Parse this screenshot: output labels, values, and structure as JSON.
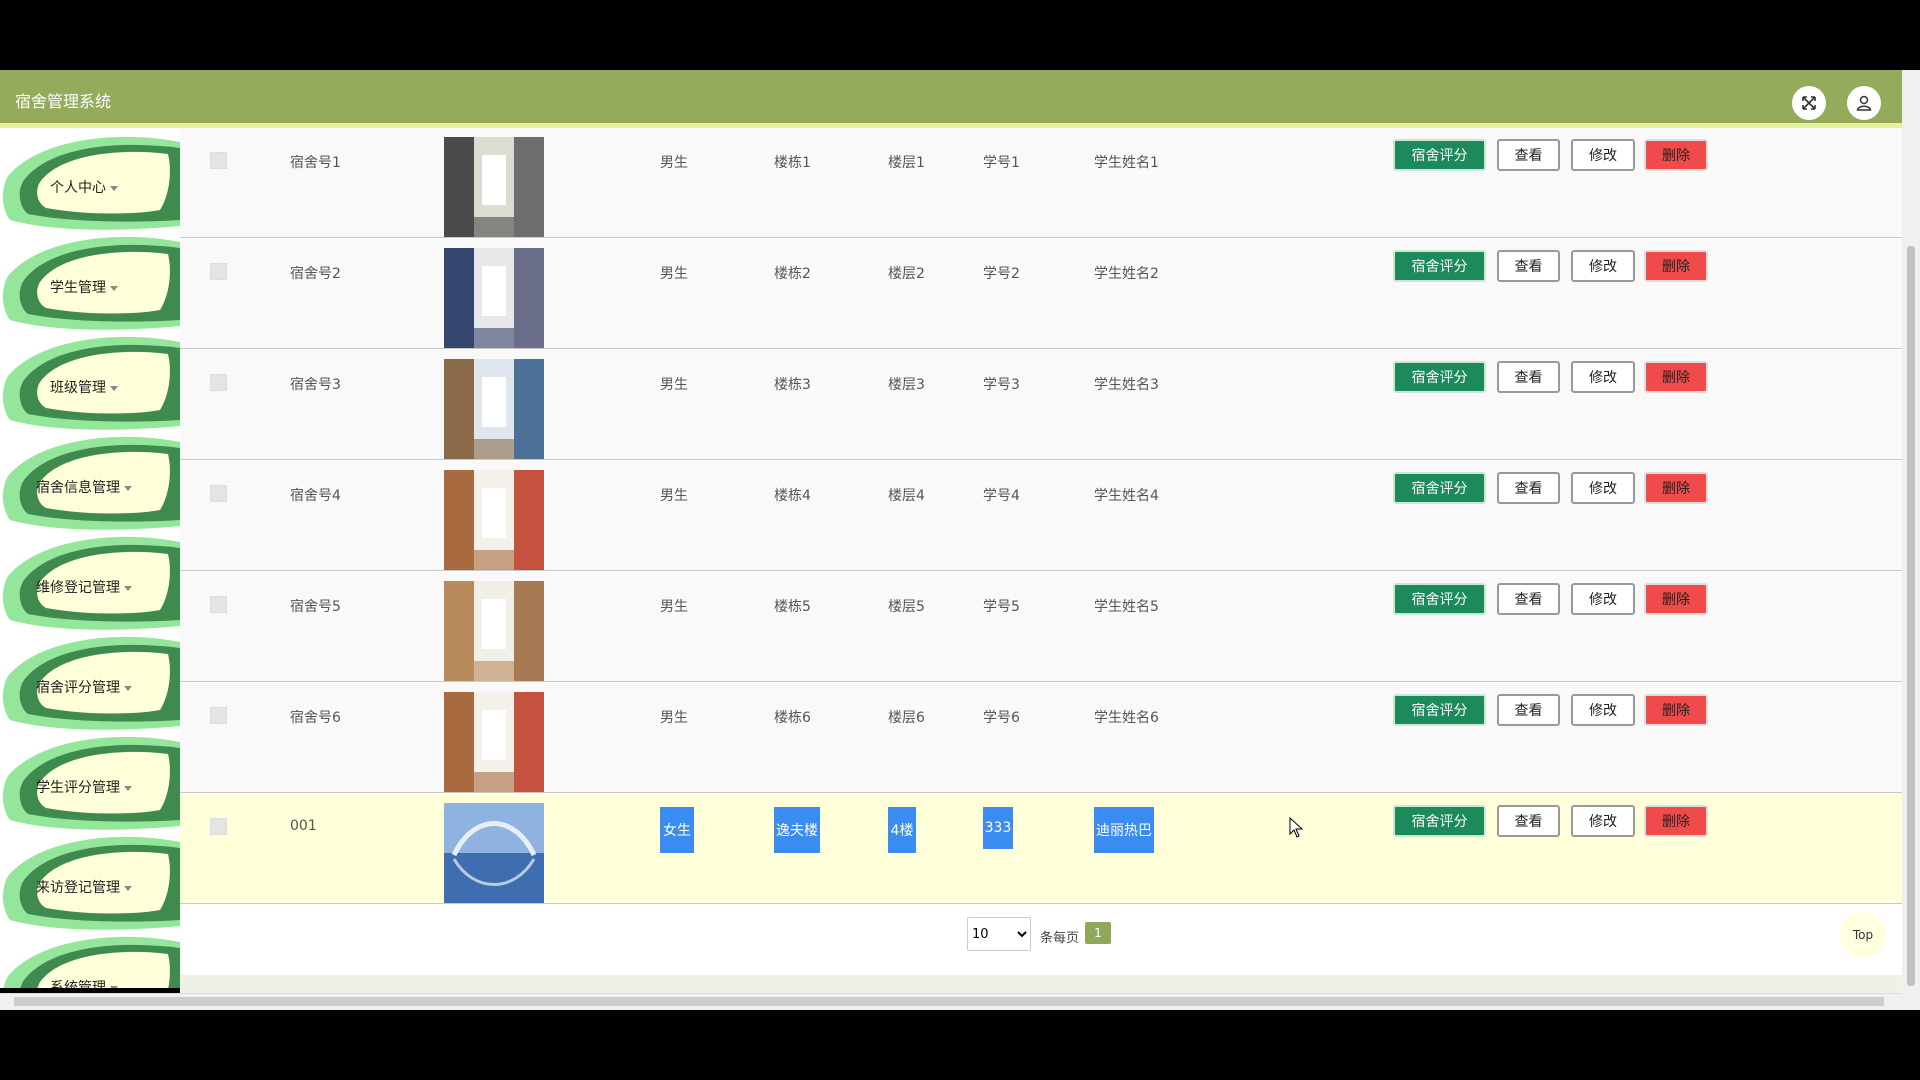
{
  "app": {
    "title": "宿舍管理系统"
  },
  "sidebar": {
    "items": [
      {
        "label": "个人中心"
      },
      {
        "label": "学生管理"
      },
      {
        "label": "班级管理"
      },
      {
        "label": "宿舍信息管理"
      },
      {
        "label": "维修登记管理"
      },
      {
        "label": "宿舍评分管理"
      },
      {
        "label": "学生评分管理"
      },
      {
        "label": "来访登记管理"
      },
      {
        "label": "系统管理"
      }
    ]
  },
  "table": {
    "rows": [
      {
        "dorm": "宿舍号1",
        "gender": "男生",
        "building": "楼栋1",
        "floor": "楼层1",
        "student_id": "学号1",
        "student_name": "学生姓名1",
        "highlight": false
      },
      {
        "dorm": "宿舍号2",
        "gender": "男生",
        "building": "楼栋2",
        "floor": "楼层2",
        "student_id": "学号2",
        "student_name": "学生姓名2",
        "highlight": false
      },
      {
        "dorm": "宿舍号3",
        "gender": "男生",
        "building": "楼栋3",
        "floor": "楼层3",
        "student_id": "学号3",
        "student_name": "学生姓名3",
        "highlight": false
      },
      {
        "dorm": "宿舍号4",
        "gender": "男生",
        "building": "楼栋4",
        "floor": "楼层4",
        "student_id": "学号4",
        "student_name": "学生姓名4",
        "highlight": false
      },
      {
        "dorm": "宿舍号5",
        "gender": "男生",
        "building": "楼栋5",
        "floor": "楼层5",
        "student_id": "学号5",
        "student_name": "学生姓名5",
        "highlight": false
      },
      {
        "dorm": "宿舍号6",
        "gender": "男生",
        "building": "楼栋6",
        "floor": "楼层6",
        "student_id": "学号6",
        "student_name": "学生姓名6",
        "highlight": false
      },
      {
        "dorm": "001",
        "gender": "女生",
        "building": "逸夫楼",
        "floor": "4楼",
        "student_id": "333",
        "student_name": "迪丽热巴",
        "highlight": true
      }
    ],
    "actions": {
      "score": "宿舍评分",
      "view": "查看",
      "edit": "修改",
      "delete": "删除"
    }
  },
  "pagination": {
    "page_size": "10",
    "page_size_options": [
      "10"
    ],
    "per_page_label": "条每页",
    "current_page": "1"
  },
  "top_button": "Top",
  "colors": {
    "header": "#93ab5b",
    "sidebar_leaf": "#93e69a",
    "score_button": "#1c8a5a",
    "delete_button": "#f04a4a",
    "selection": "#3b8cf0",
    "highlight_row": "#ffffd9"
  }
}
